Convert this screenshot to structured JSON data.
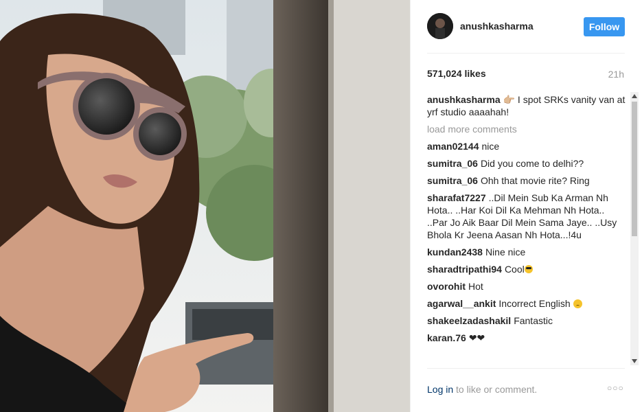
{
  "post": {
    "username": "anushkasharma",
    "follow_label": "Follow",
    "likes": "571,024 likes",
    "time": "21h",
    "caption": {
      "user": "anushkasharma",
      "text": "👉🏼 I spot SRKs vanity van at yrf studio aaaahah!"
    },
    "load_more": "load more comments",
    "comments": [
      {
        "user": "aman02144",
        "text": "nice"
      },
      {
        "user": "sumitra_06",
        "text": "Did you come to delhi??"
      },
      {
        "user": "sumitra_06",
        "text": "Ohh that movie rite? Ring"
      },
      {
        "user": "sharafat7227",
        "text": "..Dil Mein Sub Ka Arman Nh Hota.. ..Har Koi Dil Ka Mehman Nh Hota.. ..Par Jo Aik Baar Dil Mein Sama Jaye.. ..Usy Bhola Kr Jeena Aasan Nh Hota...!4u"
      },
      {
        "user": "kundan2438",
        "text": "Nine nice"
      },
      {
        "user": "sharadtripathi94",
        "text": "Cool"
      },
      {
        "user": "ovorohit",
        "text": "Hot"
      },
      {
        "user": "agarwal__ankit",
        "text": "Incorrect English"
      },
      {
        "user": "shakeelzadashakil",
        "text": "Fantastic"
      },
      {
        "user": "karan.76",
        "text": "❤❤"
      }
    ],
    "login_link": "Log in",
    "login_rest": " to like or comment.",
    "more_icon": "more-options-icon",
    "colors": {
      "accent": "#3897f0",
      "link": "#003569",
      "muted": "#999999"
    }
  }
}
